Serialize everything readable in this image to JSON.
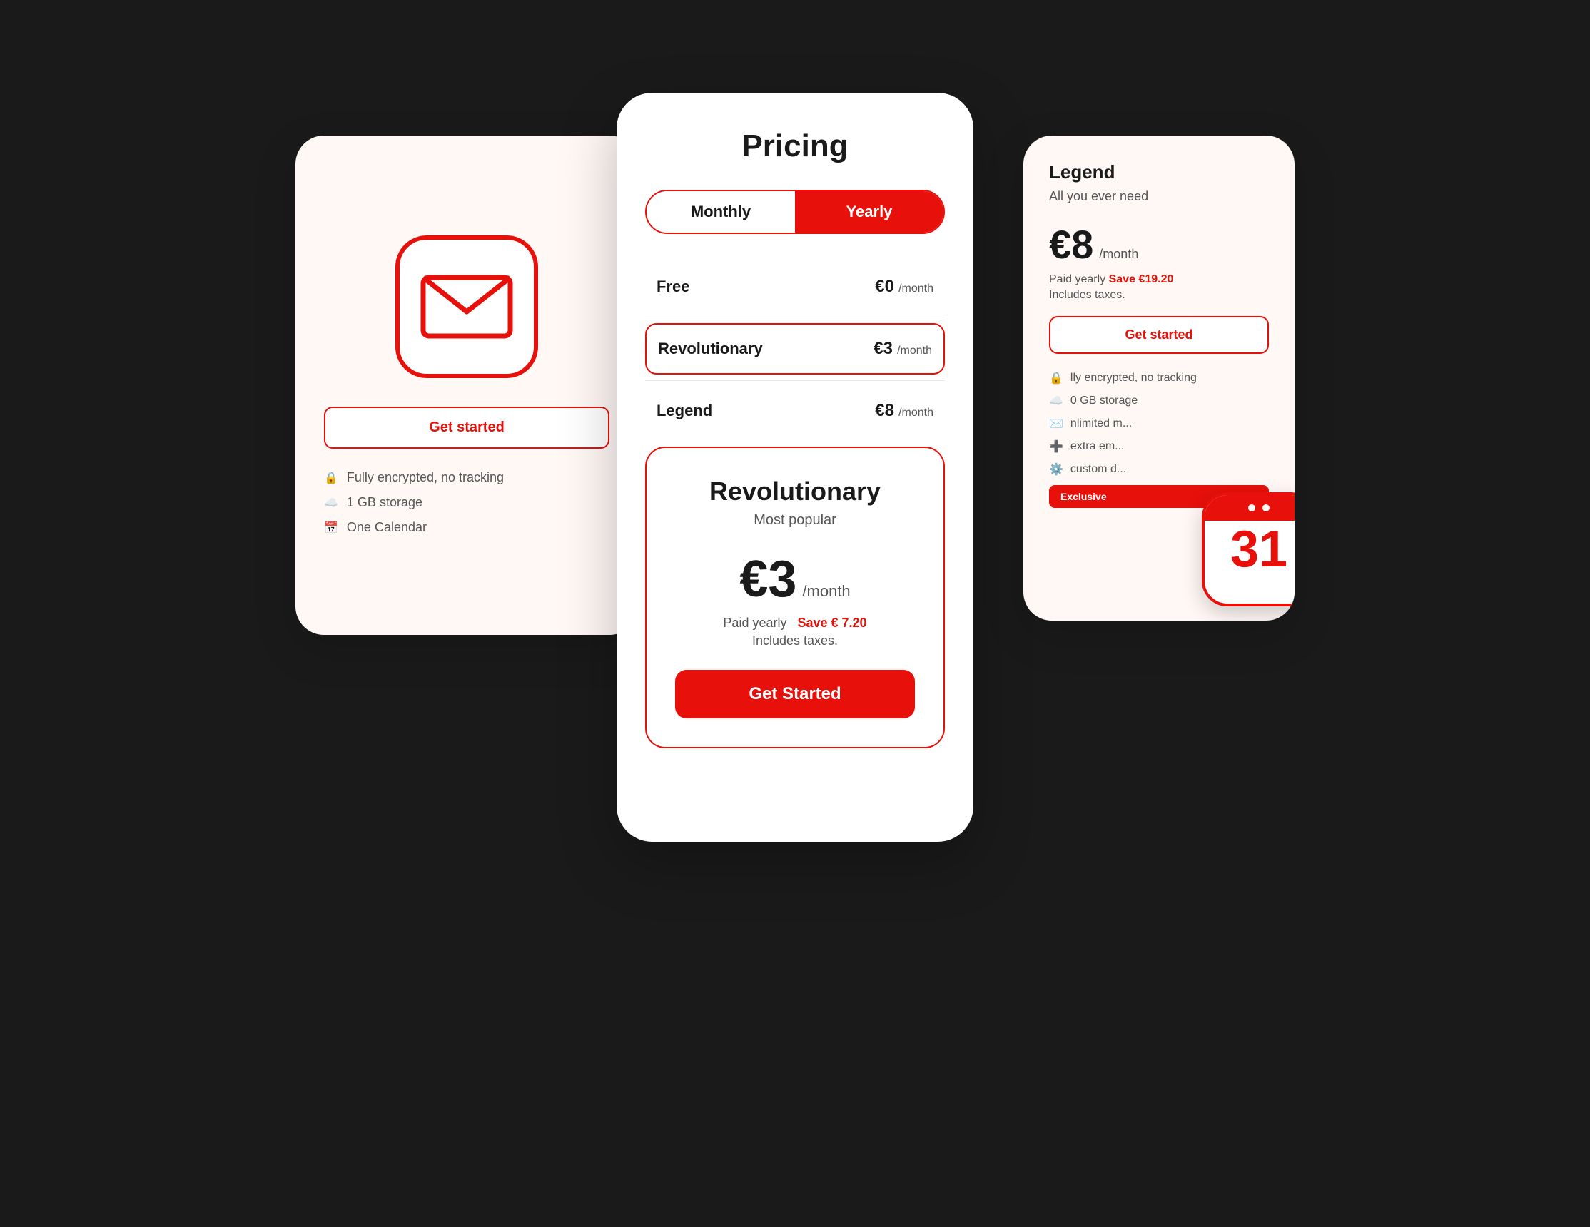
{
  "scene": {
    "background": "#1a1a1a"
  },
  "left_card": {
    "mail_icon_alt": "mail envelope icon",
    "get_started_label": "Get started",
    "features": [
      {
        "icon": "lock",
        "text": "Fully encrypted, no tracking"
      },
      {
        "icon": "cloud",
        "text": "1 GB storage"
      },
      {
        "icon": "calendar",
        "text": "One Calendar"
      }
    ]
  },
  "right_card": {
    "plan_name": "Legend",
    "subtitle": "All you ever need",
    "price": "€8",
    "period": "/month",
    "billing_text": "Paid yearly",
    "save_text": "Save €19.20",
    "taxes_text": "Includes taxes.",
    "get_started_label": "Get started",
    "features": [
      {
        "text": "lly encrypted, no tracking"
      },
      {
        "text": "0 GB storage"
      },
      {
        "text": "nlimited m..."
      },
      {
        "text": "extra em..."
      },
      {
        "text": "custom d..."
      }
    ],
    "exclusive_badge": "Exclusive",
    "calendar_number": "31"
  },
  "main_card": {
    "title": "Pricing",
    "toggle": {
      "monthly_label": "Monthly",
      "yearly_label": "Yearly",
      "active": "yearly"
    },
    "plans": [
      {
        "name": "Free",
        "price": "€0",
        "period": "/month",
        "selected": false
      },
      {
        "name": "Revolutionary",
        "price": "€3",
        "period": "/month",
        "selected": true
      },
      {
        "name": "Legend",
        "price": "€8",
        "period": "/month",
        "selected": false
      }
    ],
    "expanded_plan": {
      "name": "Revolutionary",
      "tagline": "Most popular",
      "price_main": "€3",
      "price_period": "/month",
      "billing_text": "Paid yearly",
      "save_text": "Save € 7.20",
      "taxes_text": "Includes taxes.",
      "get_started_label": "Get Started"
    }
  }
}
